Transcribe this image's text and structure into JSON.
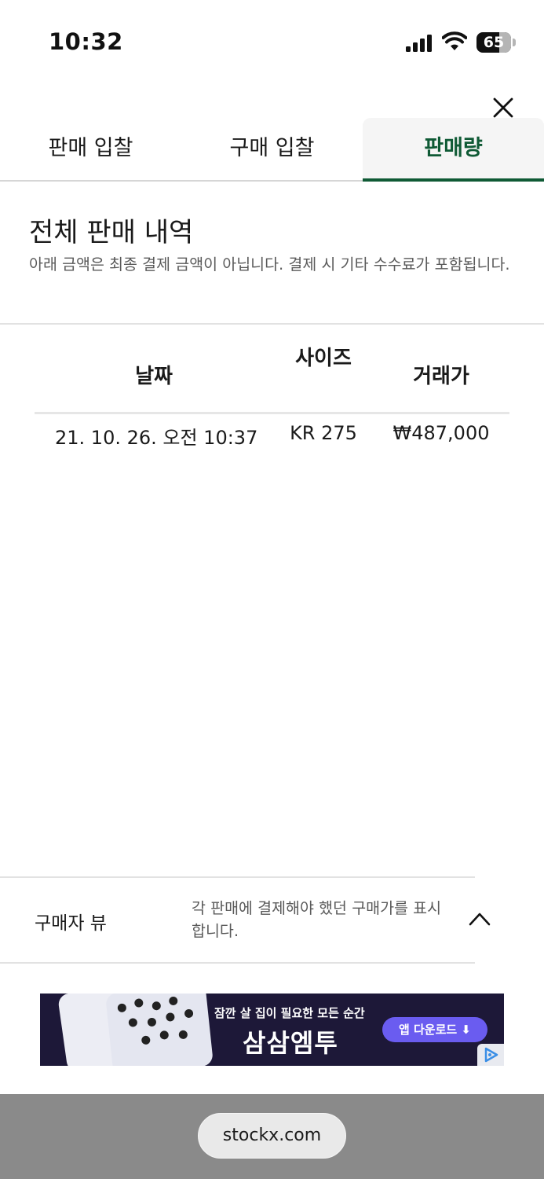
{
  "status_bar": {
    "time": "10:32",
    "battery_level": "65"
  },
  "tabs": [
    {
      "label": "판매 입찰",
      "active": false
    },
    {
      "label": "구매 입찰",
      "active": false
    },
    {
      "label": "판매량",
      "active": true
    }
  ],
  "sales_history": {
    "title": "전체 판매 내역",
    "description": "아래 금액은 최종 결제 금액이 아닙니다. 결제 시 기타 수수료가 포함됩니다.",
    "columns": [
      "날짜",
      "사이즈",
      "거래가"
    ],
    "rows": [
      {
        "date": "21. 10. 26. 오전 10:37",
        "size": "KR 275",
        "price": "₩487,000"
      }
    ]
  },
  "buyer_view": {
    "label": "구매자 뷰",
    "description": "각 판매에 결제해야 했던 구매가를 표시합니다."
  },
  "ad": {
    "tagline": "잠깐 살 집이 필요한 모든 순간",
    "brand": "삼삼엠투",
    "cta": "앱 다운로드 ⬇"
  },
  "browser": {
    "url": "stockx.com"
  },
  "colors": {
    "accent": "#0f5a35",
    "ad_background": "#1d1838",
    "ad_button": "#6a5cf0"
  }
}
